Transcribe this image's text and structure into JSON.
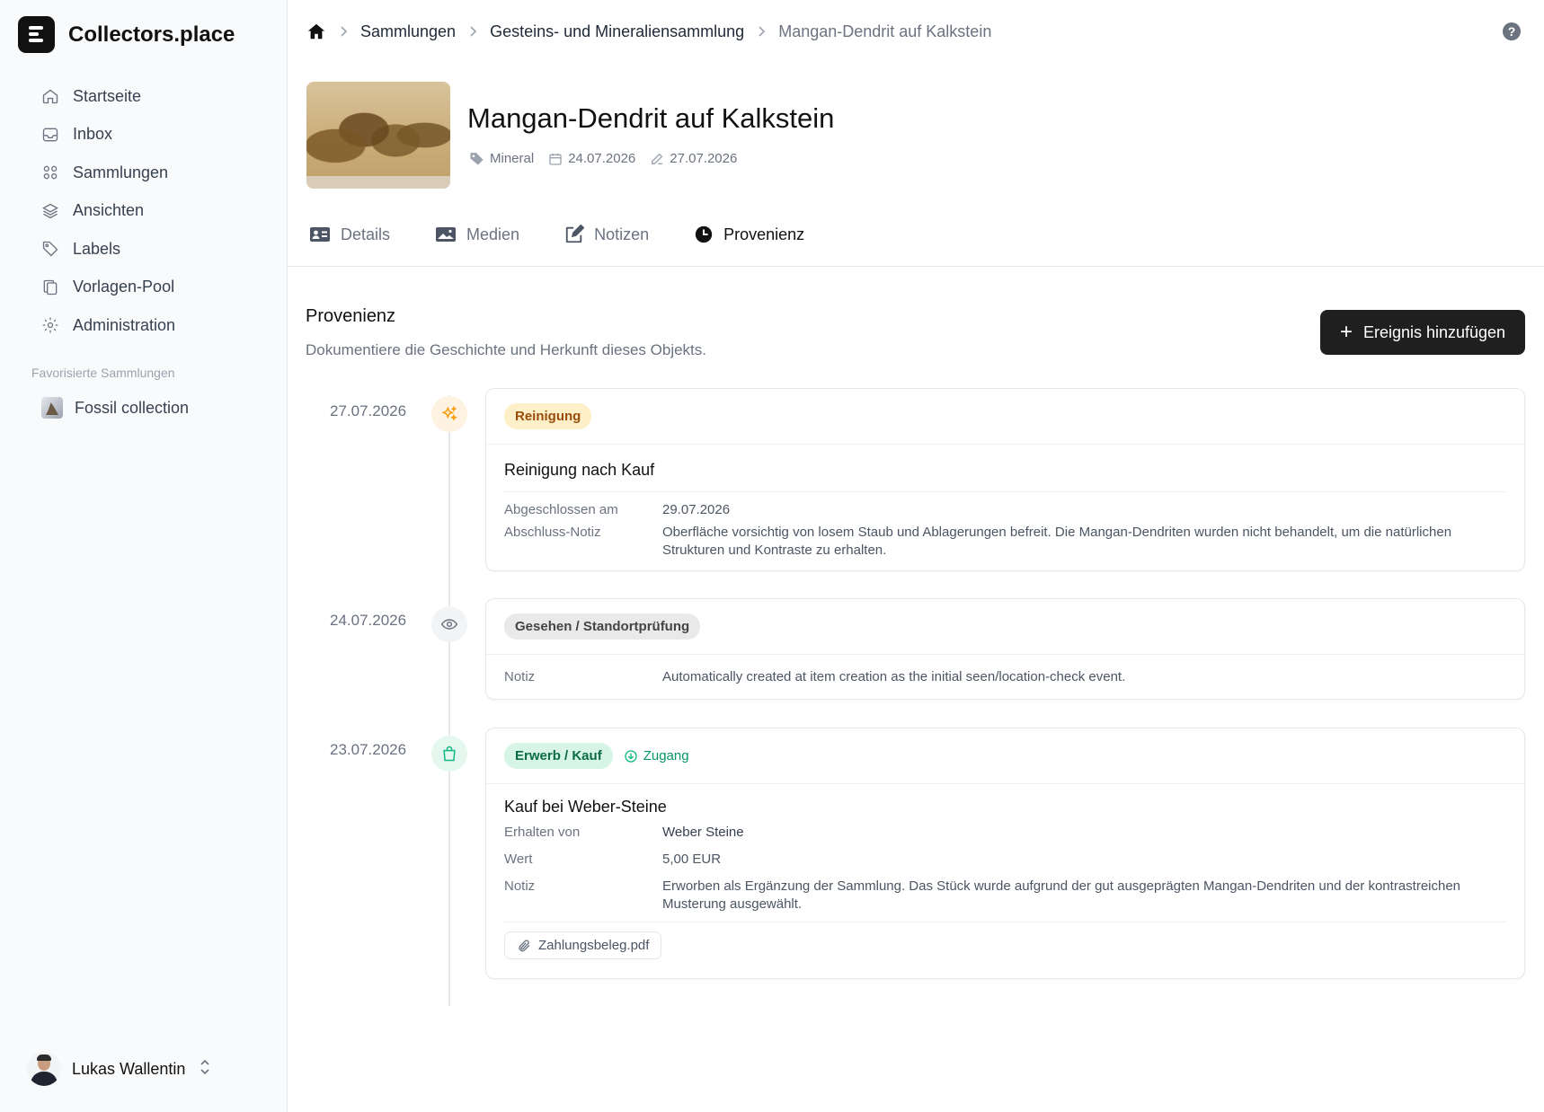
{
  "app": {
    "name": "Collectors.place"
  },
  "sidebar": {
    "items": [
      {
        "label": "Startseite",
        "icon": "home-icon"
      },
      {
        "label": "Inbox",
        "icon": "inbox-icon"
      },
      {
        "label": "Sammlungen",
        "icon": "grid-icon"
      },
      {
        "label": "Ansichten",
        "icon": "layers-icon"
      },
      {
        "label": "Labels",
        "icon": "tag-icon"
      },
      {
        "label": "Vorlagen-Pool",
        "icon": "copy-icon"
      },
      {
        "label": "Administration",
        "icon": "gear-icon"
      }
    ],
    "favorites_title": "Favorisierte Sammlungen",
    "favorites": [
      {
        "label": "Fossil collection"
      }
    ],
    "user": {
      "name": "Lukas Wallentin"
    }
  },
  "breadcrumb": {
    "items": [
      "Sammlungen",
      "Gesteins- und Mineraliensammlung"
    ],
    "current": "Mangan-Dendrit auf Kalkstein"
  },
  "item": {
    "title": "Mangan-Dendrit auf Kalkstein",
    "category": "Mineral",
    "created": "24.07.2026",
    "modified": "27.07.2026"
  },
  "tabs": [
    {
      "label": "Details",
      "icon": "id-card-icon"
    },
    {
      "label": "Medien",
      "icon": "image-icon"
    },
    {
      "label": "Notizen",
      "icon": "edit-icon"
    },
    {
      "label": "Provenienz",
      "icon": "clock-icon",
      "active": true
    }
  ],
  "provenance": {
    "title": "Provenienz",
    "subtitle": "Dokumentiere die Geschichte und Herkunft dieses Objekts.",
    "add_button": "Ereignis hinzufügen",
    "events": [
      {
        "date": "27.07.2026",
        "icon": "sparkles-icon",
        "badge": "Reinigung",
        "title": "Reinigung nach Kauf",
        "rows": [
          {
            "label": "Abgeschlossen am",
            "value": "29.07.2026"
          },
          {
            "label": "Abschluss-Notiz",
            "value": "Oberfläche vorsichtig von losem Staub und Ablagerungen befreit. Die Mangan-Dendriten wurden nicht behandelt, um die natürlichen Strukturen und Kontraste zu erhalten."
          }
        ]
      },
      {
        "date": "24.07.2026",
        "icon": "eye-icon",
        "badge": "Gesehen / Standortprüfung",
        "rows": [
          {
            "label": "Notiz",
            "value": "Automatically created at item creation as the initial seen/location-check event."
          }
        ]
      },
      {
        "date": "23.07.2026",
        "icon": "shopping-bag-icon",
        "badge": "Erwerb / Kauf",
        "badge_extra": "Zugang",
        "title": "Kauf bei Weber-Steine",
        "rows": [
          {
            "label": "Erhalten von",
            "value": "Weber Steine"
          },
          {
            "label": "Wert",
            "value": "5,00 EUR"
          },
          {
            "label": "Notiz",
            "value": "Erworben als Ergänzung der Sammlung. Das Stück wurde aufgrund der gut ausgeprägten Mangan-Dendriten und der kontrastreichen Musterung ausgewählt."
          }
        ],
        "attachment": "Zahlungsbeleg.pdf"
      }
    ]
  },
  "colors": {
    "accent_dark": "#1f1f1f",
    "reinigung_badge_bg": "#fdefc8",
    "reinigung_badge_text": "#9a4d0b",
    "erwerb_badge_bg": "#d7f5e6",
    "erwerb_badge_text": "#0b6b42"
  }
}
